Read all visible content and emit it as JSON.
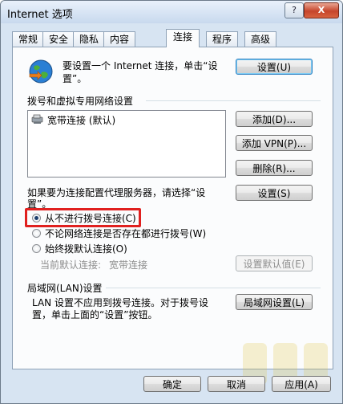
{
  "window": {
    "title": "Internet 选项",
    "help_label": "?",
    "close_label": "X"
  },
  "tabs": [
    {
      "label": "常规"
    },
    {
      "label": "安全"
    },
    {
      "label": "隐私"
    },
    {
      "label": "内容"
    },
    {
      "label": "连接",
      "active": true
    },
    {
      "label": "程序"
    },
    {
      "label": "高级"
    }
  ],
  "setup": {
    "text_line1": "要设置一个 Internet 连接，单击“设",
    "text_line2": "置”。",
    "button": "设置(U)"
  },
  "dialup": {
    "section_title": "拨号和虚拟专用网络设置",
    "connections": [
      {
        "label": "宽带连接 (默认)"
      }
    ],
    "add_button": "添加(D)...",
    "add_vpn_button": "添加 VPN(P)...",
    "delete_button": "删除(R)...",
    "proxy_text_line1": "如果要为连接配置代理服务器，请选择“设",
    "proxy_text_line2": "置”。",
    "settings_button": "设置(S)",
    "options": [
      {
        "label": "从不进行拨号连接(C)",
        "selected": true
      },
      {
        "label": "不论网络连接是否存在都进行拨号(W)",
        "selected": false
      },
      {
        "label": "始终拨默认连接(O)",
        "selected": false
      }
    ],
    "current_default_label": "当前默认连接:",
    "current_default_value": "宽带连接",
    "set_default_button": "设置默认值(E)"
  },
  "lan": {
    "section_title": "局域网(LAN)设置",
    "text_line1": "LAN 设置不应用到拨号连接。对于拨号设",
    "text_line2": "置，单击上面的“设置”按钮。",
    "button": "局域网设置(L)"
  },
  "footer": {
    "ok_button": "确定",
    "cancel_button": "取消",
    "apply_button": "应用(A)"
  },
  "colors": {
    "highlight": "#e0201f",
    "accent": "#2e7fbf"
  }
}
